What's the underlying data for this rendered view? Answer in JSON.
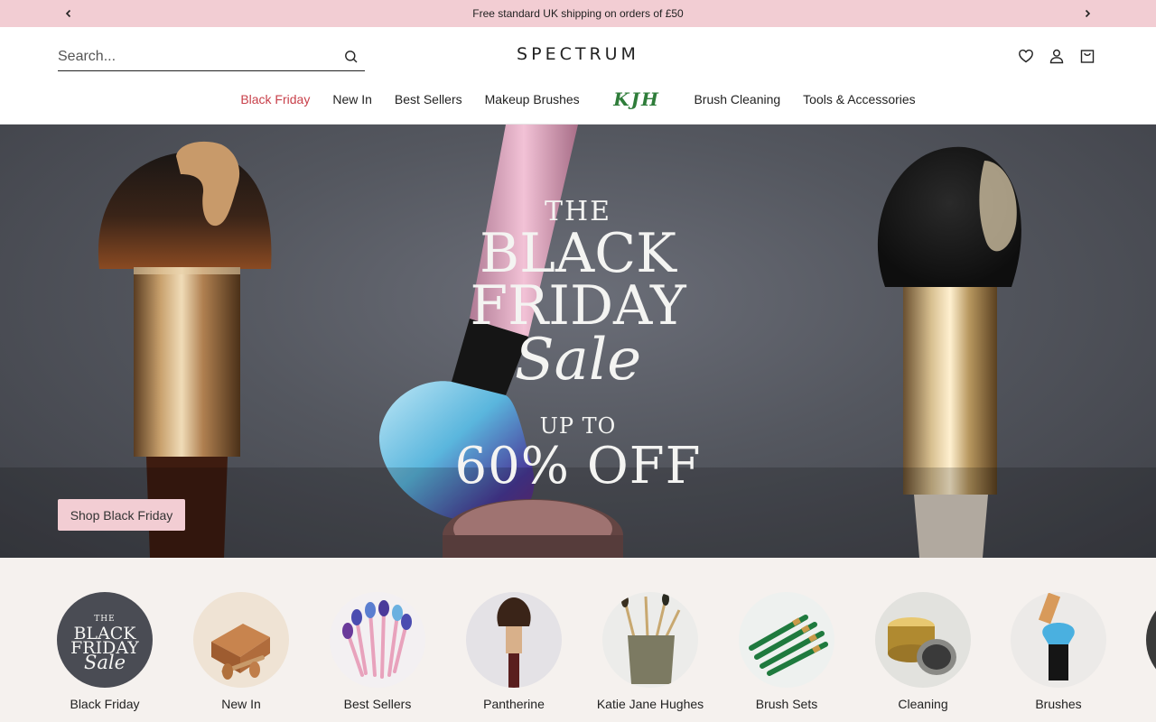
{
  "announcement": {
    "text": "Free standard UK shipping on orders of £50",
    "prev_icon": "chevron-left-icon",
    "next_icon": "chevron-right-icon"
  },
  "header": {
    "search_placeholder": "Search...",
    "logo": "SPECTRUM",
    "icons": [
      "heart-icon",
      "user-icon",
      "bag-icon"
    ]
  },
  "nav": {
    "items": [
      "Black Friday",
      "New In",
      "Best Sellers",
      "Makeup Brushes",
      "KJH",
      "Brush Cleaning",
      "Tools & Accessories"
    ],
    "sale_color": "#c8404a",
    "kjh_color": "#2f7d3a"
  },
  "hero": {
    "line1": "THE",
    "line2": "BLACK",
    "line3": "FRIDAY",
    "line4": "Sale",
    "line5": "UP TO",
    "line6": "60% OFF",
    "button": "Shop Black Friday",
    "button_color": "#f2cdd3"
  },
  "categories": {
    "items": [
      {
        "label": "Black Friday",
        "badge": [
          "THE",
          "BLACK",
          "FRIDAY",
          "Sale"
        ]
      },
      {
        "label": "New In"
      },
      {
        "label": "Best Sellers"
      },
      {
        "label": "Pantherine"
      },
      {
        "label": "Katie Jane Hughes"
      },
      {
        "label": "Brush Sets"
      },
      {
        "label": "Cleaning"
      },
      {
        "label": "Brushes"
      }
    ]
  }
}
